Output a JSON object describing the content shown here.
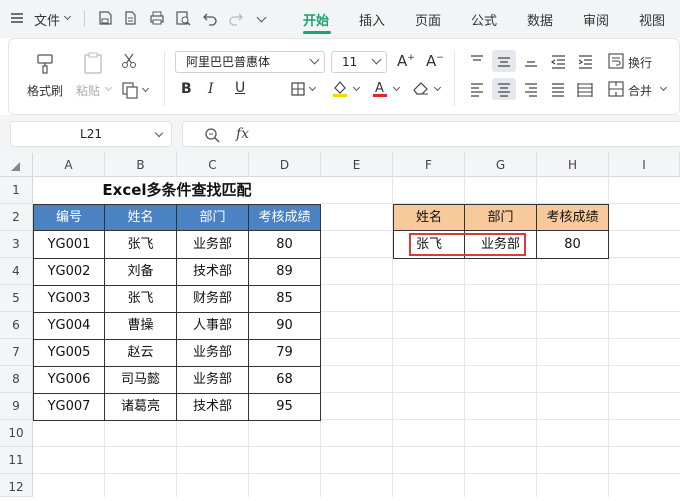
{
  "menu": {
    "file_label": "文件",
    "tabs": [
      "开始",
      "插入",
      "页面",
      "公式",
      "数据",
      "审阅",
      "视图"
    ],
    "active_tab_index": 0
  },
  "ribbon": {
    "format_painter": "格式刷",
    "paste": "粘贴",
    "font_name": "阿里巴巴普惠体",
    "font_size": "11",
    "wrap_text": "换行",
    "merge": "合并"
  },
  "formula_bar": {
    "name_box": "L21",
    "fx_label": "fx",
    "formula": ""
  },
  "sheet": {
    "columns": [
      "A",
      "B",
      "C",
      "D",
      "E",
      "F",
      "G",
      "H",
      "I"
    ],
    "rows": [
      "1",
      "2",
      "3",
      "4",
      "5",
      "6",
      "7",
      "8",
      "9",
      "10",
      "11",
      "12"
    ],
    "title": "Excel多条件查找匹配",
    "table_headers": [
      "编号",
      "姓名",
      "部门",
      "考核成绩"
    ],
    "table_rows": [
      [
        "YG001",
        "张飞",
        "业务部",
        "80"
      ],
      [
        "YG002",
        "刘备",
        "技术部",
        "89"
      ],
      [
        "YG003",
        "张飞",
        "财务部",
        "85"
      ],
      [
        "YG004",
        "曹操",
        "人事部",
        "90"
      ],
      [
        "YG005",
        "赵云",
        "业务部",
        "79"
      ],
      [
        "YG006",
        "司马懿",
        "业务部",
        "68"
      ],
      [
        "YG007",
        "诸葛亮",
        "技术部",
        "95"
      ]
    ],
    "lookup_headers": [
      "姓名",
      "部门",
      "考核成绩"
    ],
    "lookup_row": [
      "张飞",
      "业务部",
      "80"
    ]
  },
  "colors": {
    "accent": "#1aa36a",
    "table_header_bg": "#4a82c4",
    "lookup_header_bg": "#f8c99b",
    "highlight_border": "#d93b3b"
  }
}
